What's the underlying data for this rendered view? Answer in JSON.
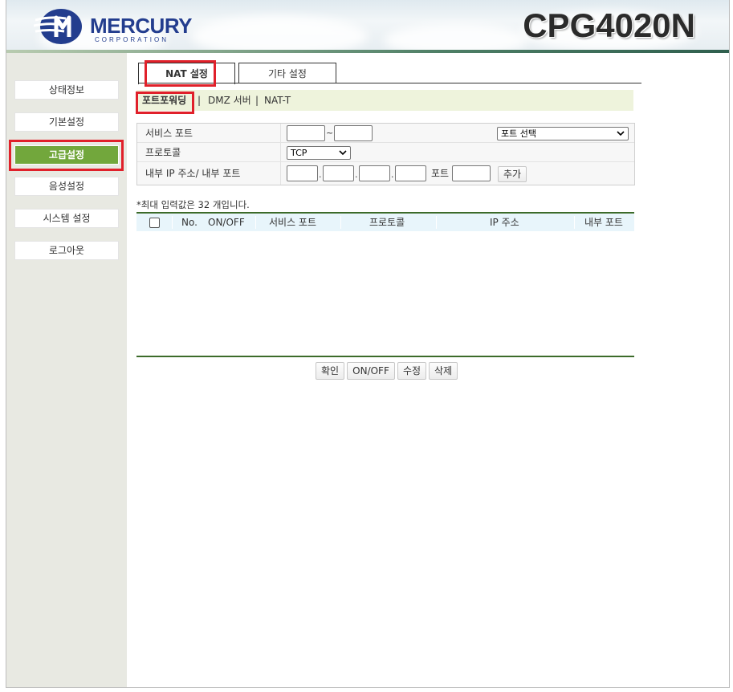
{
  "brand": {
    "name": "MERCURY",
    "sub": "CORPORATION",
    "model": "CPG4020N",
    "colors": {
      "primary": "#233d8e",
      "accent_green": "#72a73c",
      "highlight_red": "#e0202a"
    }
  },
  "sidebar": {
    "items": [
      {
        "label": "상태정보"
      },
      {
        "label": "기본설정"
      },
      {
        "label": "고급설정",
        "active": true
      },
      {
        "label": "음성설정"
      },
      {
        "label": "시스템 설정"
      },
      {
        "label": "로그아웃"
      }
    ]
  },
  "tabs": [
    {
      "label": "NAT 설정",
      "active": true
    },
    {
      "label": "기타 설정"
    }
  ],
  "subnav": {
    "items": [
      "포트포워딩",
      "DMZ 서버",
      "NAT-T"
    ],
    "separator": "|"
  },
  "form": {
    "service_port": {
      "label": "서비스 포트",
      "tilde": "~",
      "select_value": "포트 선택"
    },
    "protocol": {
      "label": "프로토콜",
      "select_value": "TCP"
    },
    "internal": {
      "label": "내부 IP 주소/ 내부 포트",
      "dot": ".",
      "port_label": "포트",
      "add_button": "추가"
    }
  },
  "note": "*최대 입력값은 32 개입니다.",
  "table": {
    "headers": [
      "No.",
      "ON/OFF",
      "서비스 포트",
      "프로토콜",
      "IP 주소",
      "내부 포트"
    ],
    "rows": []
  },
  "buttons": {
    "confirm": "확인",
    "onoff": "ON/OFF",
    "edit": "수정",
    "delete": "삭제"
  }
}
